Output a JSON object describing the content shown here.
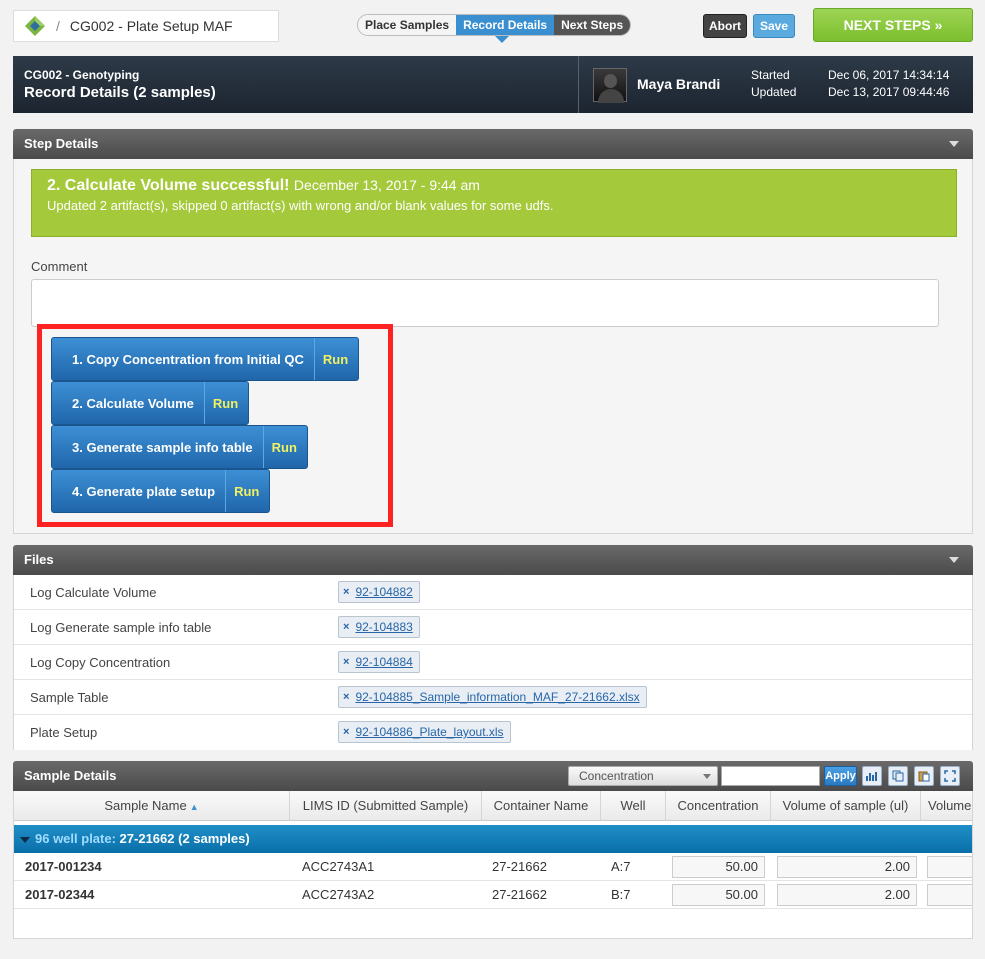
{
  "breadcrumb": {
    "title": "CG002 - Plate Setup MAF",
    "separator": "/"
  },
  "step_nav": {
    "place": "Place Samples",
    "record": "Record Details",
    "next": "Next Steps"
  },
  "actions": {
    "abort": "Abort",
    "save": "Save",
    "next_steps": "NEXT STEPS »"
  },
  "header": {
    "project": "CG002 - Genotyping",
    "heading": "Record Details",
    "sample_count": "(2 samples)",
    "user": "Maya Brandi",
    "started_label": "Started",
    "updated_label": "Updated",
    "started": "Dec 06, 2017 14:34:14",
    "updated": "Dec 13, 2017 09:44:46"
  },
  "step_details": {
    "title": "Step Details",
    "success_title": "2. Calculate Volume successful!",
    "success_date": "December 13, 2017 - 9:44 am",
    "success_msg": "Updated 2 artifact(s), skipped 0 artifact(s) with wrong and/or blank values for some udfs.",
    "comment_label": "Comment",
    "scripts": [
      {
        "label": "1. Copy Concentration from Initial QC",
        "run": "Run"
      },
      {
        "label": "2. Calculate Volume",
        "run": "Run"
      },
      {
        "label": "3. Generate sample info table",
        "run": "Run"
      },
      {
        "label": "4. Generate plate setup",
        "run": "Run"
      }
    ]
  },
  "files": {
    "title": "Files",
    "rows": [
      {
        "name": "Log Calculate Volume",
        "file": "92-104882"
      },
      {
        "name": "Log Generate sample info table",
        "file": "92-104883"
      },
      {
        "name": "Log Copy Concentration",
        "file": "92-104884"
      },
      {
        "name": "Sample Table",
        "file": "92-104885_Sample_information_MAF_27-21662.xlsx"
      },
      {
        "name": "Plate Setup",
        "file": "92-104886_Plate_layout.xls"
      }
    ],
    "remove_glyph": "×"
  },
  "sample_details": {
    "title": "Sample Details",
    "field_select": "Concentration",
    "apply": "Apply",
    "columns": [
      "Sample Name",
      "LIMS ID (Submitted Sample)",
      "Container Name",
      "Well",
      "Concentration",
      "Volume of sample (ul)",
      "Volume"
    ],
    "sort_glyph": "▲",
    "group": {
      "prefix": "96 well plate:",
      "name": "27-21662",
      "count": "(2 samples)"
    },
    "rows": [
      {
        "sample": "2017-001234",
        "lims": "ACC2743A1",
        "container": "27-21662",
        "well": "A:7",
        "conc": "50.00",
        "vol": "2.00"
      },
      {
        "sample": "2017-02344",
        "lims": "ACC2743A2",
        "container": "27-21662",
        "well": "B:7",
        "conc": "50.00",
        "vol": "2.00"
      }
    ]
  },
  "colors": {
    "accent": "#3a8fd0",
    "success": "#a4c93a",
    "highlight": "#ff2222",
    "next_steps": "#7bbf2e"
  }
}
